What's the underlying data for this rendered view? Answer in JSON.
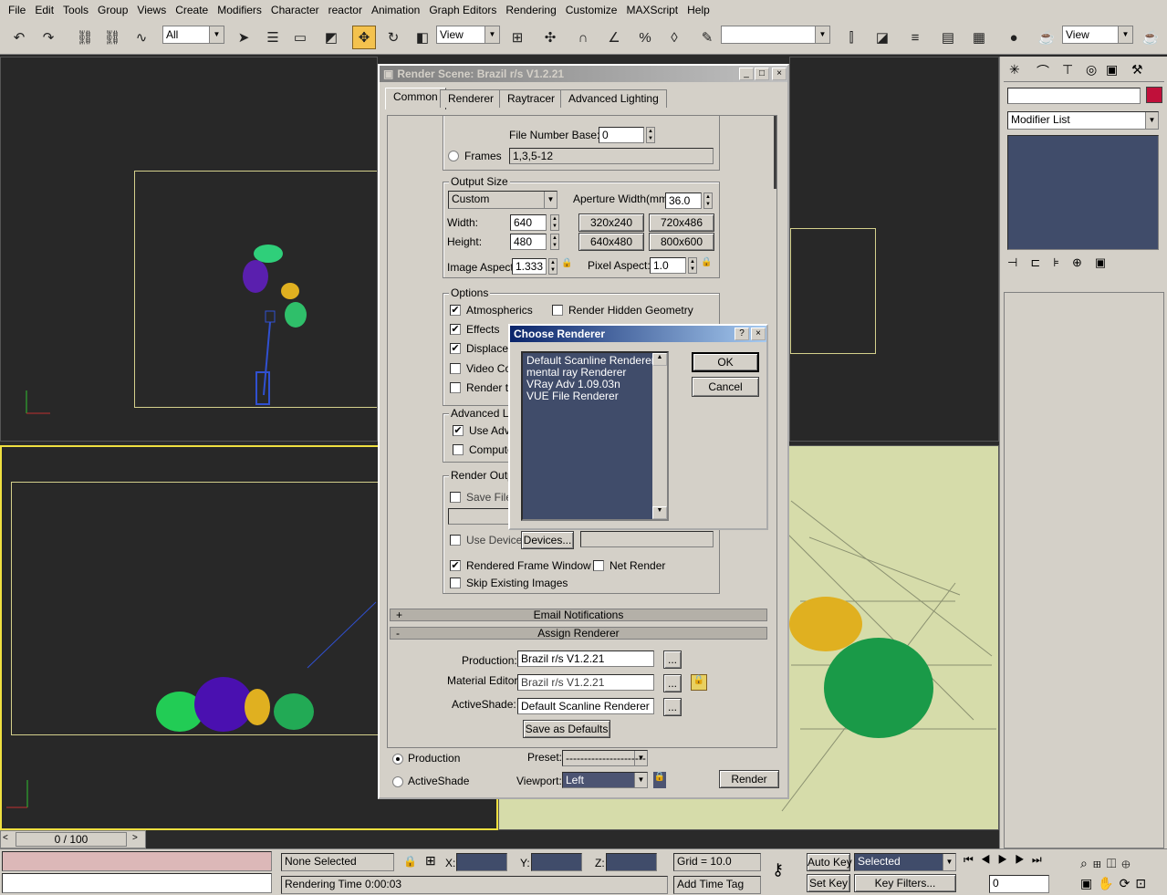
{
  "menu": [
    "File",
    "Edit",
    "Tools",
    "Group",
    "Views",
    "Create",
    "Modifiers",
    "Character",
    "reactor",
    "Animation",
    "Graph Editors",
    "Rendering",
    "Customize",
    "MAXScript",
    "Help"
  ],
  "toolbar": {
    "selection_filter": "All",
    "ref_coord": "View",
    "named_sel": "",
    "view2": "View"
  },
  "cmd": {
    "name_field": "",
    "modifier_list": "Modifier List"
  },
  "render": {
    "title": "Render Scene: Brazil r/s V1.2.21",
    "tabs": [
      "Common",
      "Renderer",
      "Raytracer",
      "Advanced Lighting"
    ],
    "file_number_base_label": "File Number Base:",
    "file_number_base": "0",
    "frames_label": "Frames",
    "frames_value": "1,3,5-12",
    "output_size_label": "Output Size",
    "size_preset": "Custom",
    "aperture_label": "Aperture Width(mm):",
    "aperture": "36.0",
    "width_label": "Width:",
    "width": "640",
    "height_label": "Height:",
    "height": "480",
    "presets": [
      "320x240",
      "720x486",
      "640x480",
      "800x600"
    ],
    "image_aspect_label": "Image Aspect:",
    "image_aspect": "1.333",
    "pixel_aspect_label": "Pixel Aspect:",
    "pixel_aspect": "1.0",
    "options_label": "Options",
    "opt_atmospherics": "Atmospherics",
    "opt_hidden": "Render Hidden Geometry",
    "opt_effects": "Effects",
    "opt_displace": "Displacem",
    "opt_video": "Video Colo",
    "opt_render_to": "Render to",
    "adv_light_label": "Advanced Lig",
    "use_adv": "Use Adva",
    "compute": "Compute",
    "render_output_label": "Render Outpu",
    "save_file": "Save File",
    "use_device": "Use Device",
    "devices": "Devices...",
    "rendered_frame_window": "Rendered Frame Window",
    "net_render": "Net Render",
    "skip_existing": "Skip Existing Images",
    "email_notifications": "Email Notifications",
    "assign_renderer": "Assign Renderer",
    "production_label": "Production:",
    "production_value": "Brazil r/s V1.2.21",
    "material_editor_label": "Material Editor:",
    "material_editor_value": "Brazil r/s V1.2.21",
    "activeshade_label": "ActiveShade:",
    "activeshade_value": "Default Scanline Renderer",
    "ellipsis": "...",
    "save_defaults": "Save as Defaults",
    "mode_production": "Production",
    "mode_activeshade": "ActiveShade",
    "preset_label": "Preset:",
    "preset_value": "----------------------",
    "viewport_label": "Viewport:",
    "viewport_value": "Left",
    "render_button": "Render"
  },
  "choose": {
    "title": "Choose Renderer",
    "help": "?",
    "close": "×",
    "items": [
      "Default Scanline Renderer",
      "mental ray Renderer",
      "VRay Adv 1.09.03n",
      "VUE File Renderer"
    ],
    "ok": "OK",
    "cancel": "Cancel"
  },
  "timeline": {
    "frame": "0 / 100"
  },
  "status": {
    "selection": "None Selected",
    "x_label": "X:",
    "y_label": "Y:",
    "z_label": "Z:",
    "grid": "Grid = 10.0",
    "auto_key": "Auto Key",
    "selected": "Selected",
    "set_key": "Set Key",
    "key_filters": "Key Filters...",
    "rendering_time": "Rendering Time  0:00:03",
    "add_time_tag": "Add Time Tag",
    "frame_field": "0"
  },
  "colors": {
    "accent_yellow": "#f4c24e",
    "viewport_bg": "#282828",
    "perspective_bg": "#d6dcaa"
  }
}
